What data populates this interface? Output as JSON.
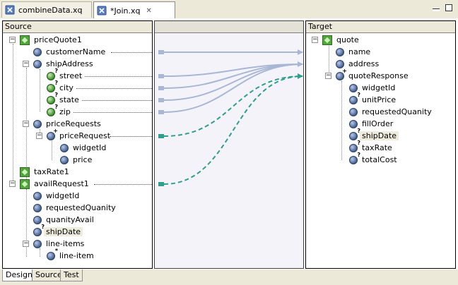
{
  "tabs": [
    {
      "label": "combineData.xq"
    },
    {
      "label": "*Join.xq"
    }
  ],
  "source_header": "Source",
  "target_header": "Target",
  "source_nodes": [
    {
      "label": "priceQuote1",
      "icon": "element-icon"
    },
    {
      "label": "customerName",
      "icon": "attribute-icon"
    },
    {
      "label": "shipAddress",
      "icon": "attribute-icon"
    },
    {
      "label": "street",
      "icon": "optional-attribute-icon"
    },
    {
      "label": "city",
      "icon": "optional-attribute-icon"
    },
    {
      "label": "state",
      "icon": "optional-attribute-icon"
    },
    {
      "label": "zip",
      "icon": "optional-attribute-icon"
    },
    {
      "label": "priceRequests",
      "icon": "attribute-icon"
    },
    {
      "label": "priceRequest",
      "icon": "repeating-attribute-icon"
    },
    {
      "label": "widgetId",
      "icon": "attribute-icon"
    },
    {
      "label": "price",
      "icon": "attribute-icon"
    },
    {
      "label": "taxRate1",
      "icon": "element-icon"
    },
    {
      "label": "availRequest1",
      "icon": "element-icon"
    },
    {
      "label": "widgetId",
      "icon": "attribute-icon"
    },
    {
      "label": "requestedQuanity",
      "icon": "attribute-icon"
    },
    {
      "label": "quanityAvail",
      "icon": "attribute-icon"
    },
    {
      "label": "shipDate",
      "icon": "optional-attribute-icon"
    },
    {
      "label": "line-items",
      "icon": "attribute-icon"
    },
    {
      "label": "line-item",
      "icon": "repeating-attribute-icon"
    }
  ],
  "target_nodes": [
    {
      "label": "quote",
      "icon": "element-icon"
    },
    {
      "label": "name",
      "icon": "attribute-icon"
    },
    {
      "label": "address",
      "icon": "attribute-icon"
    },
    {
      "label": "quoteResponse",
      "icon": "repeating-attribute-icon"
    },
    {
      "label": "widgetId",
      "icon": "attribute-icon"
    },
    {
      "label": "unitPrice",
      "icon": "optional-attribute-icon"
    },
    {
      "label": "requestedQuanity",
      "icon": "attribute-icon"
    },
    {
      "label": "fillOrder",
      "icon": "attribute-icon"
    },
    {
      "label": "shipDate",
      "icon": "optional-attribute-icon"
    },
    {
      "label": "taxRate",
      "icon": "optional-attribute-icon"
    },
    {
      "label": "totalCost",
      "icon": "optional-attribute-icon"
    }
  ],
  "bottom_tabs": [
    {
      "label": "Design"
    },
    {
      "label": "Source"
    },
    {
      "label": "Test"
    }
  ],
  "colors": {
    "solid_link": "#a8b7d3",
    "dashed_link": "#2f9e8c"
  }
}
